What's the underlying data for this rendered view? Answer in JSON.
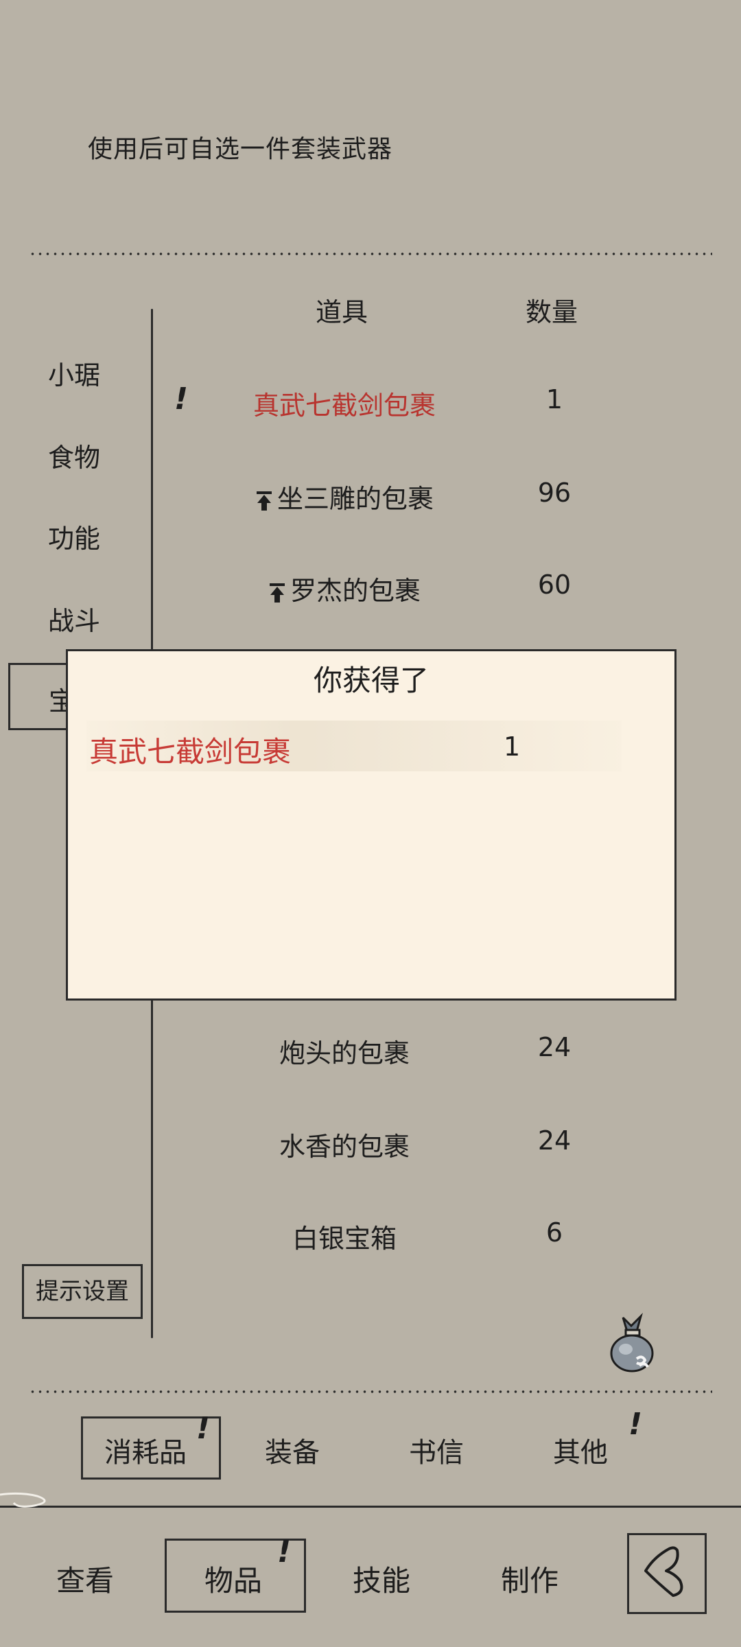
{
  "description": "使用后可自选一件套装武器",
  "columns": {
    "item": "道具",
    "qty": "数量"
  },
  "side_tabs": [
    "小琚",
    "食物",
    "功能",
    "战斗"
  ],
  "side_selected_partial": "宝",
  "items": [
    {
      "name": "真武七截剑包裹",
      "qty": "1",
      "highlight": true,
      "alert": "!"
    },
    {
      "name": "坐三雕的包裹",
      "qty": "96",
      "icon": "pin-up-icon"
    },
    {
      "name": "罗杰的包裹",
      "qty": "60",
      "icon": "pin-up-icon"
    },
    {
      "name": "炮头的包裹",
      "qty": "24"
    },
    {
      "name": "水香的包裹",
      "qty": "24"
    },
    {
      "name": "白银宝箱",
      "qty": "6"
    }
  ],
  "hint_button": "提示设置",
  "modal": {
    "title": "你获得了",
    "item_name": "真武七截剑包裹",
    "item_qty": "1"
  },
  "sub_tabs": [
    {
      "label": "消耗品",
      "selected": true,
      "alert": "!"
    },
    {
      "label": "装备"
    },
    {
      "label": "书信"
    },
    {
      "label": "其他",
      "alert": "!"
    }
  ],
  "main_tabs": [
    {
      "label": "查看"
    },
    {
      "label": "物品",
      "selected": true,
      "alert": "!"
    },
    {
      "label": "技能"
    },
    {
      "label": "制作"
    }
  ],
  "icons": {
    "bag": "money-bag-icon",
    "back": "back-arrow-icon"
  },
  "colors": {
    "background": "#b8b2a6",
    "highlight_red": "#b8342f",
    "modal_bg": "#fbf2e3"
  }
}
